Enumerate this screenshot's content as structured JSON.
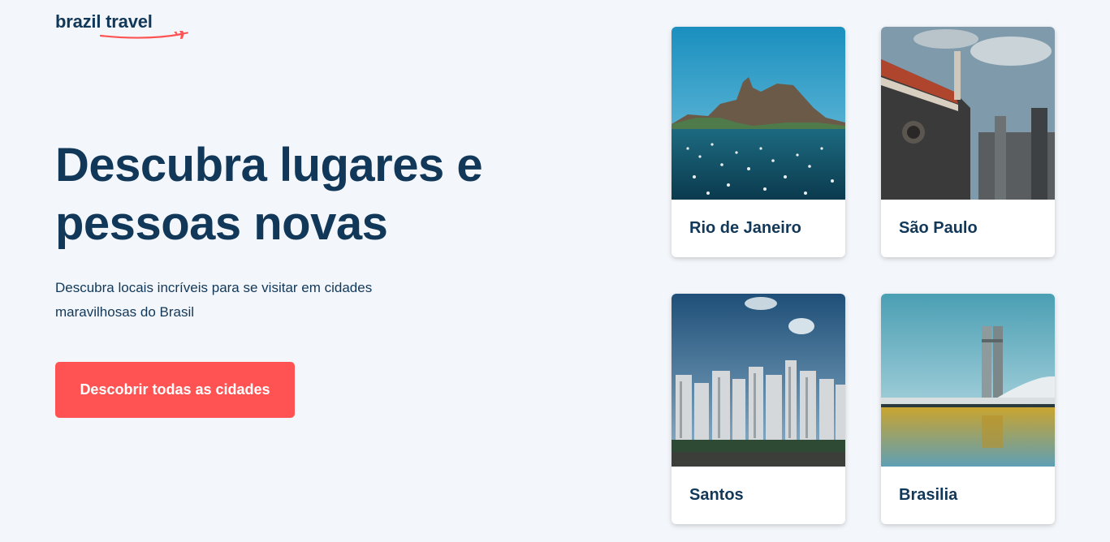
{
  "brand": {
    "logo_text": "brazil travel",
    "accent_color": "#ff5353",
    "text_color": "#123859",
    "background_color": "#f3f6fa"
  },
  "hero": {
    "title": "Descubra lugares e pessoas novas",
    "subtitle": "Descubra locais incríveis para se visitar em cidades maravilhosas do Brasil",
    "cta_label": "Descobrir todas as cidades"
  },
  "cities": [
    {
      "name": "Rio de Janeiro",
      "image": "rio-sugarloaf-bay-photo"
    },
    {
      "name": "São Paulo",
      "image": "sao-paulo-building-photo"
    },
    {
      "name": "Santos",
      "image": "santos-skyline-photo"
    },
    {
      "name": "Brasilia",
      "image": "brasilia-congress-photo"
    }
  ]
}
